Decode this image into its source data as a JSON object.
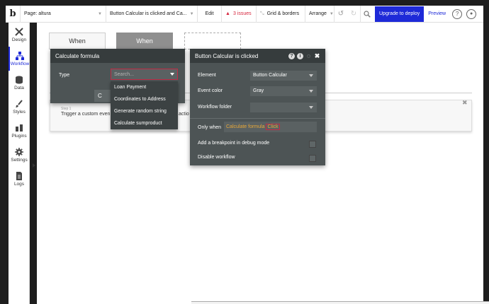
{
  "topbar": {
    "logo": "b",
    "page_label": "Page: altura",
    "event_label": "Button Calcular is clicked and Ca...",
    "edit_label": "Edit",
    "issues_label": "3 issues",
    "grid_label": "Grid & borders",
    "arrange_label": "Arrange",
    "deploy_label": "Upgrade to deploy",
    "preview_label": "Preview",
    "icons": [
      "undo-icon",
      "redo-icon",
      "search-icon",
      "help-icon",
      "user-icon"
    ]
  },
  "sidebar": {
    "items": [
      {
        "label": "Design",
        "icon": "design-tools-icon"
      },
      {
        "label": "Workflow",
        "icon": "workflow-icon",
        "active": true
      },
      {
        "label": "Data",
        "icon": "database-icon"
      },
      {
        "label": "Styles",
        "icon": "brush-icon"
      },
      {
        "label": "Plugins",
        "icon": "plug-icon"
      },
      {
        "label": "Settings",
        "icon": "gear-icon"
      },
      {
        "label": "Logs",
        "icon": "document-icon"
      }
    ]
  },
  "canvas": {
    "cards": [
      "When",
      "When"
    ],
    "step_label": "Step 1",
    "step_text": "Trigger a custom even",
    "step_text_cut": "actio",
    "button_stub": "C"
  },
  "calc_panel": {
    "title": "Calculate formula",
    "type_label": "Type",
    "search_placeholder": "Search...",
    "options": [
      "Loan Payment",
      "Coordinates to Address",
      "Generate random string",
      "Calculate sumproduct"
    ]
  },
  "props_panel": {
    "title": "Button Calcular is clicked",
    "element_label": "Element",
    "element_value": "Button Calcular",
    "event_color_label": "Event color",
    "event_color_value": "Gray",
    "folder_label": "Workflow folder",
    "folder_value": "",
    "only_when_label": "Only when",
    "only_when_expr": "Calculate formula",
    "only_when_click": "Click",
    "breakpoint_label": "Add a breakpoint in debug mode",
    "disable_label": "Disable workflow"
  },
  "colors": {
    "accent": "#1e2ad8",
    "issues": "#d6263e",
    "panel_bg": "#4d5455",
    "panel_head": "#363c3d",
    "expression": "#e8a838"
  }
}
